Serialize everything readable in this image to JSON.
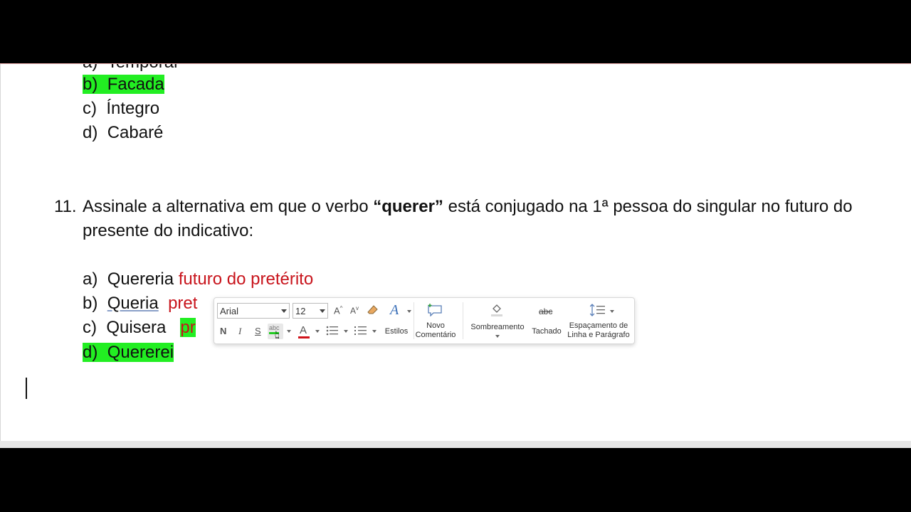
{
  "document": {
    "prev_question": {
      "options": [
        {
          "marker": "a)",
          "text": "Temporal",
          "highlight": false,
          "clipped": true
        },
        {
          "marker": "b)",
          "text": "Facada",
          "highlight": true
        },
        {
          "marker": "c)",
          "text": "Íntegro",
          "highlight": false
        },
        {
          "marker": "d)",
          "text": "Cabaré",
          "highlight": false
        }
      ]
    },
    "question": {
      "number": "11.",
      "text_before": "Assinale a alternativa em que o verbo ",
      "text_bold": "“querer”",
      "text_after": " está conjugado na 1ª pessoa do singular no futuro do presente do indicativo:",
      "options": [
        {
          "marker": "a)",
          "text": "Quereria",
          "annotation": "futuro do pretérito"
        },
        {
          "marker": "b)",
          "text": "Queria",
          "annotation": "pret"
        },
        {
          "marker": "c)",
          "text": "Quisera",
          "annotation": "pr"
        },
        {
          "marker": "d)",
          "text": "Quererei",
          "annotation": ""
        }
      ]
    }
  },
  "colors": {
    "highlight": "#22ee22",
    "annotation_red": "#c8141c"
  },
  "mini_toolbar": {
    "font_name": "Arial",
    "font_size": "12",
    "grow_font_icon": "A",
    "shrink_font_icon": "A",
    "clear_format_icon": "eraser-icon",
    "bold": "N",
    "italic": "I",
    "underline": "S",
    "highlight_icon": "abc",
    "font_color_icon": "A",
    "styles_icon": "A",
    "styles_label": "Estilos",
    "new_comment_label_1": "Novo",
    "new_comment_label_2": "Comentário",
    "shading_label": "Sombreamento",
    "strikethrough_icon": "abc",
    "strikethrough_label": "Tachado",
    "spacing_label_1": "Espaçamento de",
    "spacing_label_2": "Linha e Parágrafo"
  }
}
